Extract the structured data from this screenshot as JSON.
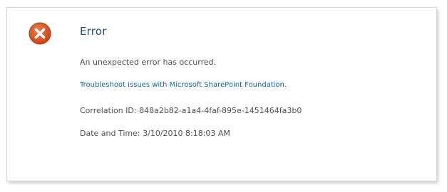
{
  "error": {
    "title": "Error",
    "message": "An unexpected error has occurred.",
    "link_text": "Troubleshoot issues with Microsoft SharePoint Foundation.",
    "correlation_label": "Correlation ID:",
    "correlation_id": "848a2b82-a1a4-4faf-895e-1451464fa3b0",
    "datetime_label": "Date and Time:",
    "datetime_value": "3/10/2010 8:18:03 AM"
  },
  "icons": {
    "error_icon": "error-x-icon"
  },
  "colors": {
    "icon_red": "#d9501a",
    "title_blue": "#1e4e79",
    "link_blue": "#0b6aa8",
    "text_gray": "#4f4f4f"
  }
}
